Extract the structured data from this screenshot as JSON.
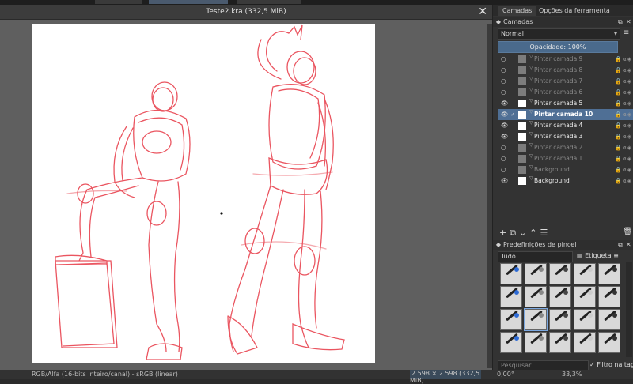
{
  "document": {
    "title": "Teste2.kra (332,5 MiB)",
    "close_symbol": "✕"
  },
  "status": {
    "color_info": "RGB/Alfa (16-bits inteiro/canal) - sRGB (linear)",
    "size_info": "2.598 × 2.598 (332,5 MiB)",
    "angle": "0,00°",
    "zoom": "33,3%"
  },
  "panel": {
    "tabs": [
      "Camadas",
      "Opções da ferramenta"
    ],
    "layers_title": "Camadas",
    "blend_mode": "Normal",
    "opacity_label": "Opacidade:  100%",
    "layers": [
      {
        "name": "Pintar camada 9",
        "visible": false,
        "selected": false
      },
      {
        "name": "Pintar camada 8",
        "visible": false,
        "selected": false
      },
      {
        "name": "Pintar camada 7",
        "visible": false,
        "selected": false
      },
      {
        "name": "Pintar camada 6",
        "visible": false,
        "selected": false
      },
      {
        "name": "Pintar camada 5",
        "visible": true,
        "selected": false
      },
      {
        "name": "Pintar camada 10",
        "visible": true,
        "selected": true
      },
      {
        "name": "Pintar camada 4",
        "visible": true,
        "selected": false
      },
      {
        "name": "Pintar camada 3",
        "visible": true,
        "selected": false
      },
      {
        "name": "Pintar camada 2",
        "visible": false,
        "selected": false
      },
      {
        "name": "Pintar camada 1",
        "visible": false,
        "selected": false
      },
      {
        "name": "Background",
        "visible": false,
        "selected": false
      },
      {
        "name": "Background",
        "visible": true,
        "selected": false
      }
    ],
    "brushes_title": "Predefinições de pincel",
    "tag_filter": "Tudo",
    "tag_label": "Etiqueta",
    "search_placeholder": "Pesquisar",
    "filter_label": "Filtro na tag"
  },
  "colors": {
    "accent": "#4f6f95",
    "sketch": "#e8434f"
  }
}
